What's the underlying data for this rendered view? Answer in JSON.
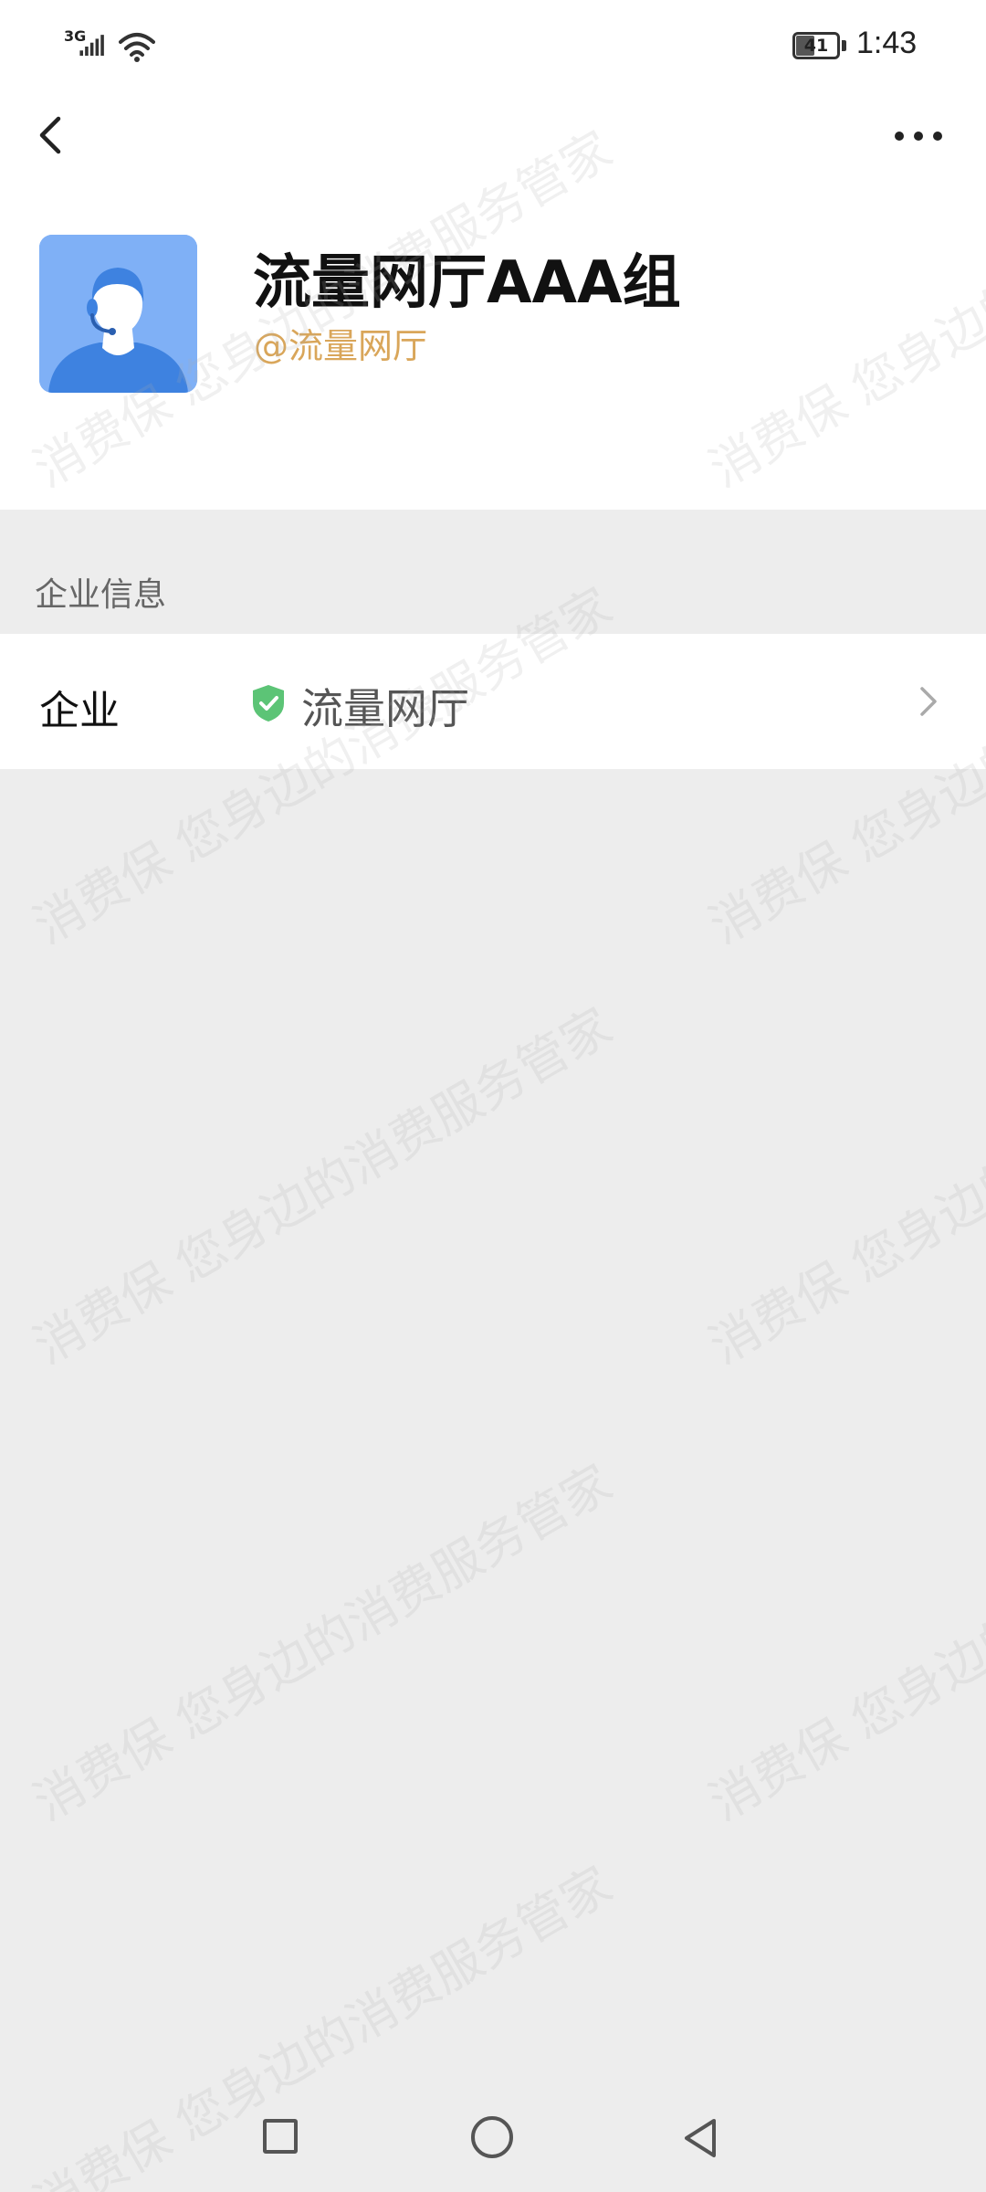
{
  "status_bar": {
    "network": "3G",
    "battery_level": "41",
    "time": "1:43"
  },
  "nav": {
    "back_icon": "chevron-left-icon",
    "more_icon": "more-horizontal-icon"
  },
  "profile": {
    "name": "流量网厅AAA组",
    "handle": "@流量网厅",
    "avatar_icon": "customer-service-agent-avatar"
  },
  "section": {
    "title": "企业信息"
  },
  "info_row": {
    "label": "企业",
    "value": "流量网厅",
    "verified_icon": "shield-check-icon",
    "chevron_icon": "chevron-right-icon"
  },
  "watermark": {
    "text_a": "消费保 您身边的消费服务管家"
  },
  "system_nav": {
    "recents_icon": "square-icon",
    "home_icon": "circle-icon",
    "back_icon": "triangle-back-icon"
  },
  "colors": {
    "background": "#ededed",
    "handle": "#d9a65a",
    "verified_green": "#5cc476",
    "avatar_bg": "#7fb0f6"
  }
}
